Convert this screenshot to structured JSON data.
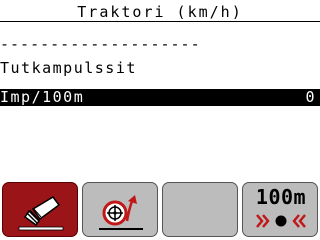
{
  "header": {
    "title": "Traktori (km/h)"
  },
  "content": {
    "separator": "--------------------",
    "section_label": "Tutkampulssit",
    "selected_row": {
      "label": "Imp/100m",
      "value": "0"
    }
  },
  "softkeys": [
    {
      "icon": "calibrate-disc-icon",
      "active": true
    },
    {
      "icon": "wheel-rotate-icon",
      "active": false
    },
    {
      "icon": "empty",
      "active": false
    },
    {
      "label": "100m",
      "icon": "distance-measure-icon",
      "active": false
    }
  ],
  "colors": {
    "active_key": "#9a1418",
    "inactive_key": "#bcbcbc",
    "accent_red": "#c01818",
    "highlight_bg": "#000000",
    "highlight_fg": "#ffffff"
  }
}
